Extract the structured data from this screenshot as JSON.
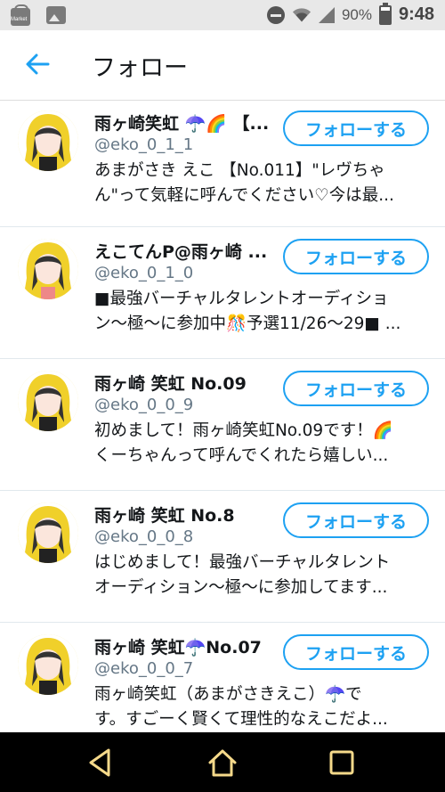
{
  "status_bar": {
    "left_icons": [
      "market-icon",
      "image-icon"
    ],
    "market_label": "Market",
    "battery_percent": "90%",
    "time": "9:48"
  },
  "header": {
    "title": "フォロー"
  },
  "follow_label": "フォローする",
  "users": [
    {
      "name": "雨ヶ崎笑虹 ☂️🌈 【...",
      "handle": "@eko_0_1_1",
      "bio_lines": [
        "あまがさき えこ 【No.011】\"レヴちゃ",
        "ん\"って気軽に呼んでください♡今は最..."
      ]
    },
    {
      "name": "えこてんP@雨ヶ崎 ...",
      "handle": "@eko_0_1_0",
      "bio_lines": [
        "■最強バーチャルタレントオーディショ",
        "ン〜極〜に参加中🎊予選11/26〜29■ ..."
      ]
    },
    {
      "name": "雨ヶ崎 笑虹 No.09",
      "handle": "@eko_0_0_9",
      "bio_lines": [
        "初めまして！雨ヶ崎笑虹No.09です！🌈",
        "くーちゃんって呼んでくれたら嬉しい..."
      ]
    },
    {
      "name": "雨ヶ崎 笑虹 No.8",
      "handle": "@eko_0_0_8",
      "bio_lines": [
        "はじめまして！最強バーチャルタレント",
        "オーディション〜極〜に参加してます..."
      ]
    },
    {
      "name": "雨ヶ崎 笑虹☂️No.07",
      "handle": "@eko_0_0_7",
      "bio_lines": [
        "雨ヶ崎笑虹（あまがさきえこ）☂️で",
        "す。すごーく賢くて理性的なえこだよ..."
      ]
    }
  ],
  "colors": {
    "accent": "#1da1f2",
    "handle": "#657786",
    "status_bar": "#e8e8e8",
    "nav_bar": "#000000",
    "nav_glow": "#f5d98a"
  },
  "nav_icons": [
    "back-triangle-icon",
    "home-icon",
    "recents-square-icon"
  ]
}
